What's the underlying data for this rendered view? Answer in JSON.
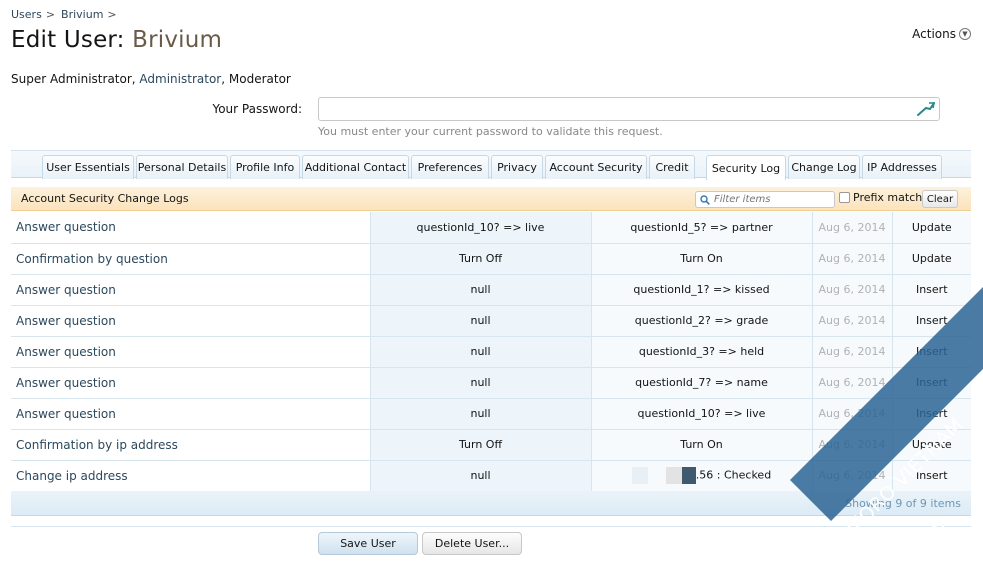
{
  "breadcrumb": {
    "items": [
      "Users",
      "Brivium"
    ],
    "separator": ">"
  },
  "title": {
    "prefix": "Edit User:",
    "name": "Brivium"
  },
  "actions": {
    "label": "Actions"
  },
  "roles": {
    "first": "Super Administrator",
    "link": "Administrator",
    "last": "Moderator"
  },
  "password": {
    "label": "Your Password:",
    "value": "",
    "hint": "You must enter your current password to validate this request."
  },
  "tabs": [
    "User Essentials",
    "Personal Details",
    "Profile Info",
    "Additional Contact",
    "Preferences",
    "Privacy",
    "Account Security",
    "Credit",
    "Security Log",
    "Change Log",
    "IP Addresses"
  ],
  "active_tab": "Security Log",
  "section": {
    "title": "Account Security Change Logs",
    "filter_placeholder": "Filter items",
    "prefix_label": "Prefix match",
    "clear_label": "Clear"
  },
  "rows": [
    {
      "event": "Answer question",
      "old": "questionId_10? => live",
      "new": "questionId_5? => partner",
      "date": "Aug 6, 2014",
      "action": "Update"
    },
    {
      "event": "Confirmation by question",
      "old": "Turn Off",
      "new": "Turn On",
      "date": "Aug 6, 2014",
      "action": "Update"
    },
    {
      "event": "Answer question",
      "old": "null",
      "new": "questionId_1? => kissed",
      "date": "Aug 6, 2014",
      "action": "Insert"
    },
    {
      "event": "Answer question",
      "old": "null",
      "new": "questionId_2? => grade",
      "date": "Aug 6, 2014",
      "action": "Insert"
    },
    {
      "event": "Answer question",
      "old": "null",
      "new": "questionId_3? => held",
      "date": "Aug 6, 2014",
      "action": "Insert"
    },
    {
      "event": "Answer question",
      "old": "null",
      "new": "questionId_7? => name",
      "date": "Aug 6, 2014",
      "action": "Insert"
    },
    {
      "event": "Answer question",
      "old": "null",
      "new": "questionId_10? => live",
      "date": "Aug 6, 2014",
      "action": "Insert"
    },
    {
      "event": "Confirmation by ip address",
      "old": "Turn Off",
      "new": "Turn On",
      "date": "Aug 6, 2014",
      "action": "Update"
    },
    {
      "event": "Change ip address",
      "old": "null",
      "new": ".56 : Checked",
      "date": "Aug 6, 2014",
      "action": "Insert"
    }
  ],
  "footer": {
    "showing": "Showing 9 of 9 items"
  },
  "buttons": {
    "save": "Save User",
    "delete": "Delete User..."
  },
  "watermark": {
    "line1": "XENFORO VIETNAM",
    "line2": "VXF.VN"
  },
  "colors": {
    "link": "#2b485c",
    "section_head": "#fbe3bc",
    "tab_border": "#c5d8e6",
    "watermark": "#2c6494"
  }
}
